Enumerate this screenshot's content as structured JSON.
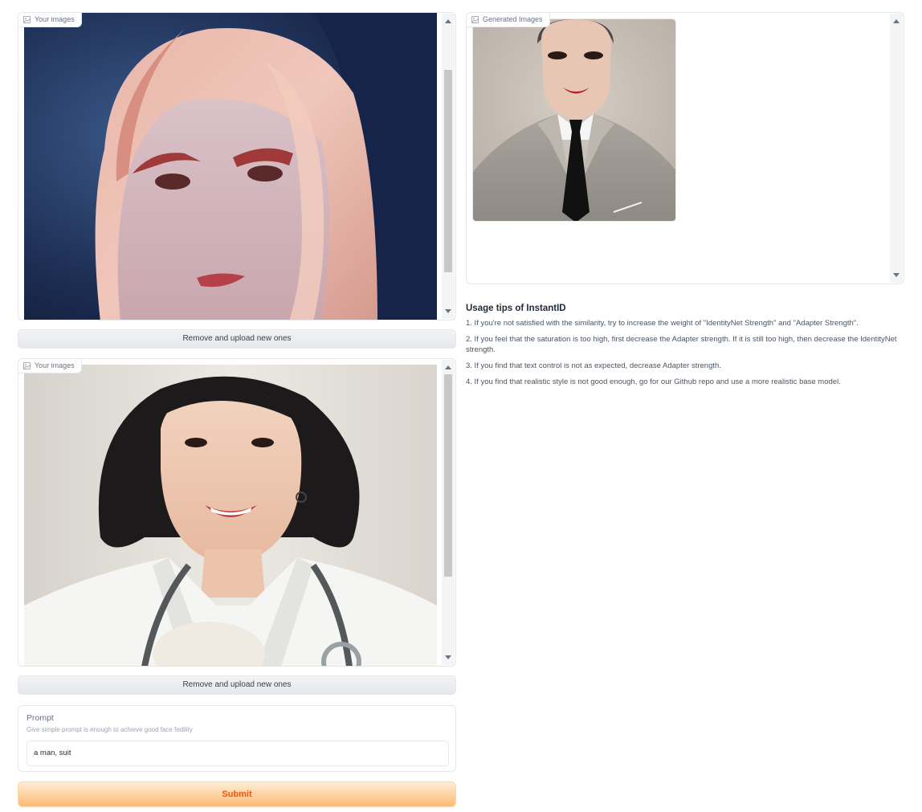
{
  "gallery_top": {
    "label": "Your images",
    "label_icon": "image-icon",
    "image_alt": "anime-style portrait with long pink hair"
  },
  "gallery_bottom": {
    "label": "Your images",
    "label_icon": "image-icon",
    "image_alt": "smiling woman doctor with stethoscope"
  },
  "remove_button_label": "Remove and upload new ones",
  "prompt": {
    "label": "Prompt",
    "info": "Give simple prompt is enough to achieve good face fedility",
    "value": "a man, suit"
  },
  "submit_label": "Submit",
  "gallery_output": {
    "label": "Generated Images",
    "label_icon": "image-icon",
    "image_alt": "generated portrait of man in grey suit with black tie"
  },
  "tips": {
    "title": "Usage tips of InstantID",
    "items": [
      "1. If you're not satisfied with the similarity, try to increase the weight of \"IdentityNet Strength\" and \"Adapter Strength\".",
      "2. If you feel that the saturation is too high, first decrease the Adapter strength. If it is still too high, then decrease the IdentityNet strength.",
      "3. If you find that text control is not as expected, decrease Adapter strength.",
      "4. If you find that realistic style is not good enough, go for our Github repo and use a more realistic base model."
    ]
  },
  "colors": {
    "accent": "#ea580c",
    "submit_gradient_top": "#ffedd5",
    "submit_gradient_bottom": "#fdba74",
    "border": "#e5e7eb"
  }
}
